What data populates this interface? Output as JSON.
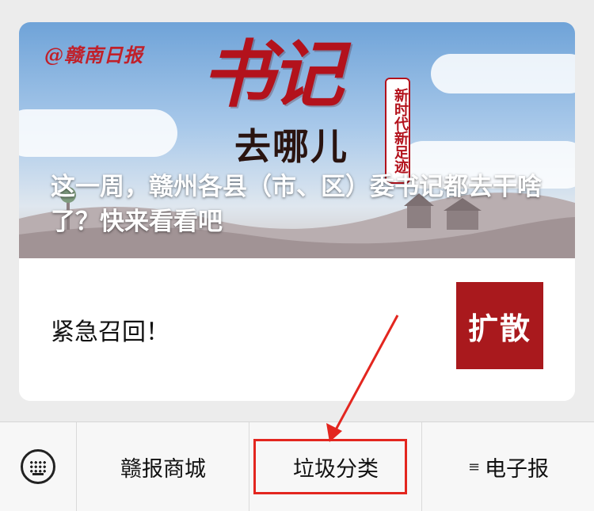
{
  "card": {
    "banner": {
      "logo_text": "@赣南日报",
      "big_title": "书记",
      "sub_title": "去哪儿",
      "vertical_tag": "新时代新足迹",
      "headline": "这一周，赣州各县（市、区）委书记都去干啥了？快来看看吧"
    },
    "item2": {
      "text": "紧急召回！",
      "thumb_text": "扩散"
    }
  },
  "menubar": {
    "keyboard_icon": "keyboard-icon",
    "items": [
      {
        "label": "赣报商城"
      },
      {
        "label": "垃圾分类"
      },
      {
        "label": "电子报",
        "icon": "menu-lines-icon"
      }
    ]
  },
  "colors": {
    "annotation_red": "#e3261f",
    "thumb_red": "#a9191d",
    "title_red": "#b3121c"
  }
}
